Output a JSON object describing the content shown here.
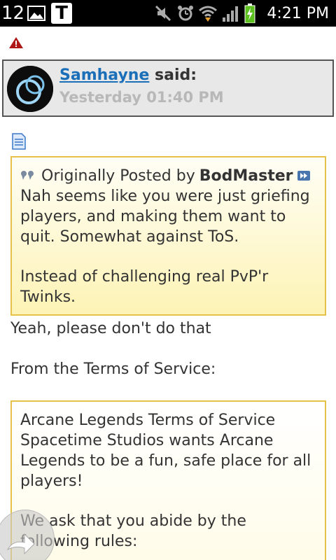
{
  "status_bar": {
    "notification_count": "12",
    "time": "4:21 PM"
  },
  "post": {
    "author": "Samhayne",
    "said": "said:",
    "timestamp": "Yesterday 01:40 PM"
  },
  "quote1": {
    "originally_posted_by": "Originally Posted by",
    "quoted_author": "BodMaster",
    "paragraph1": "Nah seems like you were just griefing players, and making them want to quit. Somewhat against ToS.",
    "paragraph2": "Instead of challenging real PvP'r Twinks."
  },
  "reply": {
    "line1": "Yeah, please don't do that",
    "line2": "From the Terms of Service:"
  },
  "quote2": {
    "paragraph1": "Arcane Legends Terms of Service Spacetime Studios wants Arcane Legends to be a fun, safe place for all players!",
    "paragraph2": "We ask that you abide by the following rules:"
  },
  "colors": {
    "link": "#1a6fb8",
    "quote_border": "#e6c24a",
    "quote_bg": "#fdf3b5"
  }
}
